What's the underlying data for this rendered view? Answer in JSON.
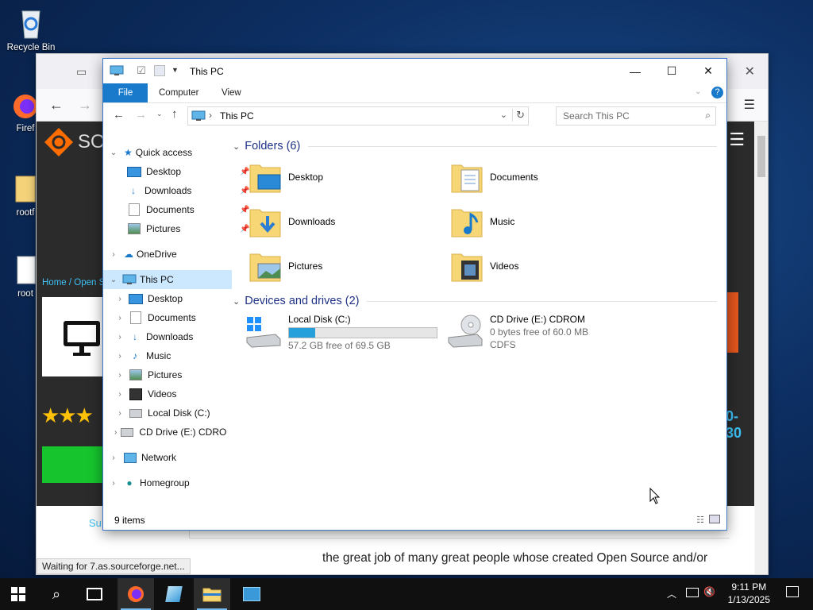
{
  "desktop": {
    "icons": [
      {
        "label": "Recycle Bin"
      },
      {
        "label": "Firef"
      },
      {
        "label": "rootf"
      },
      {
        "label": "root"
      }
    ]
  },
  "browser": {
    "breadcrumb": "Home / Open S",
    "status": "Waiting for 7.as.sourceforge.net...",
    "body_text": "the great job of many great people whose created Open Source and/or",
    "logo_text": "SO",
    "date_fragment": "0-30",
    "tab_fragment": "Su"
  },
  "explorer": {
    "title": "This PC",
    "ribbon_tabs": [
      "File",
      "Computer",
      "View"
    ],
    "address": "This PC",
    "search_placeholder": "Search This PC",
    "nav": {
      "quick_access": "Quick access",
      "quick_items": [
        "Desktop",
        "Downloads",
        "Documents",
        "Pictures"
      ],
      "onedrive": "OneDrive",
      "this_pc": "This PC",
      "pc_items": [
        "Desktop",
        "Documents",
        "Downloads",
        "Music",
        "Pictures",
        "Videos",
        "Local Disk (C:)",
        "CD Drive (E:) CDROM"
      ],
      "network": "Network",
      "homegroup": "Homegroup"
    },
    "folders_header": "Folders (6)",
    "folders": [
      "Desktop",
      "Documents",
      "Downloads",
      "Music",
      "Pictures",
      "Videos"
    ],
    "drives_header": "Devices and drives (2)",
    "drives": [
      {
        "name": "Local Disk (C:)",
        "detail": "57.2 GB free of 69.5 GB",
        "used_fraction": 0.18
      },
      {
        "name": "CD Drive (E:) CDROM",
        "detail": "0 bytes free of 60.0 MB",
        "fs": "CDFS"
      }
    ],
    "status": "9 items"
  },
  "taskbar": {
    "time": "9:11 PM",
    "date": "1/13/2025"
  },
  "colors": {
    "accent": "#1979ca",
    "selection": "#cce8ff",
    "folder": "#f7d675"
  }
}
